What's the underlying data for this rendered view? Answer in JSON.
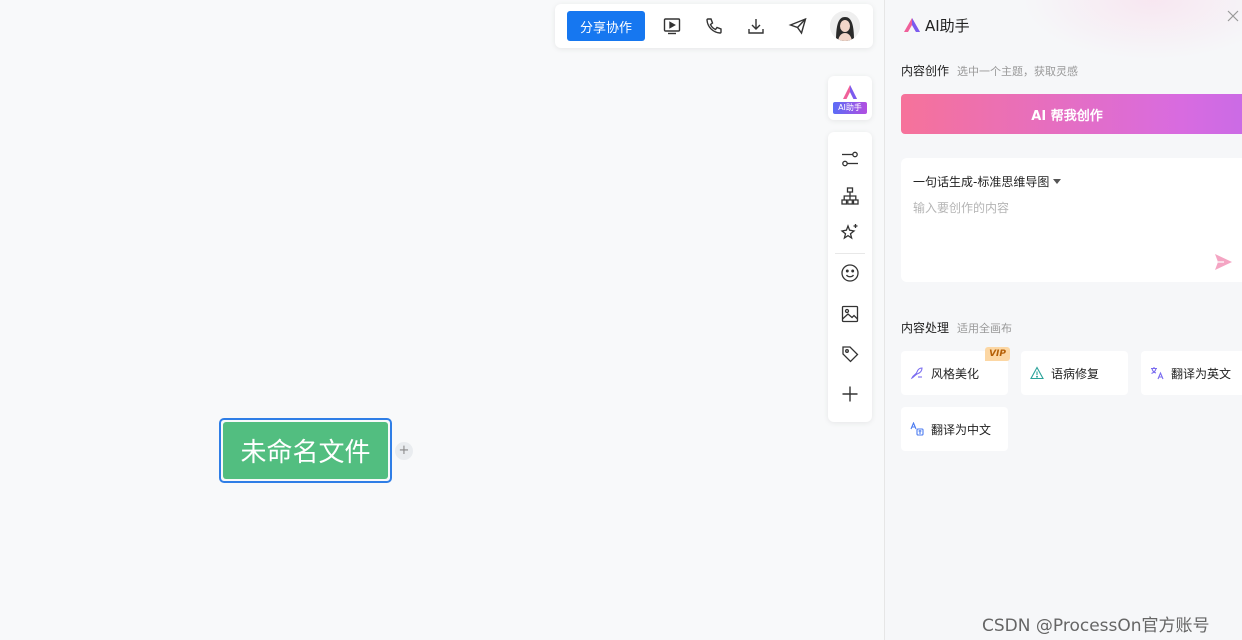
{
  "topbar": {
    "share_label": "分享协作",
    "icons": [
      "present-icon",
      "call-icon",
      "download-icon",
      "send-icon"
    ],
    "avatar": "user-avatar"
  },
  "float_ai": {
    "badge_label": "AI助手"
  },
  "toolbar": {
    "tools": [
      "relation-icon",
      "structure-icon",
      "ai-sparkle-icon",
      "emoji-icon",
      "image-icon",
      "tag-icon",
      "add-icon"
    ]
  },
  "mindmap": {
    "root_label": "未命名文件",
    "add_child_label": "+"
  },
  "watermark": "CSDN @ProcessOn官方账号",
  "panel": {
    "title": "AI助手",
    "content_create": {
      "label": "内容创作",
      "hint": "选中一个主题，获取灵感"
    },
    "ai_button_label": "AI 帮我创作",
    "input": {
      "mode": "一句话生成-标准思维导图",
      "placeholder": "输入要创作的内容",
      "value": ""
    },
    "content_process": {
      "label": "内容处理",
      "hint": "适用全画布"
    },
    "actions": [
      {
        "label": "风格美化",
        "badge": "VIP",
        "icon": "style-icon"
      },
      {
        "label": "语病修复",
        "icon": "warning-icon"
      },
      {
        "label": "翻译为英文",
        "icon": "translate-en-icon"
      },
      {
        "label": "翻译为中文",
        "icon": "translate-zh-icon"
      }
    ]
  },
  "colors": {
    "primary": "#1677f0",
    "node_green": "#52be80",
    "node_border": "#2f7ee6",
    "ai_gradient_start": "#f6729a",
    "ai_gradient_end": "#c96be6"
  }
}
